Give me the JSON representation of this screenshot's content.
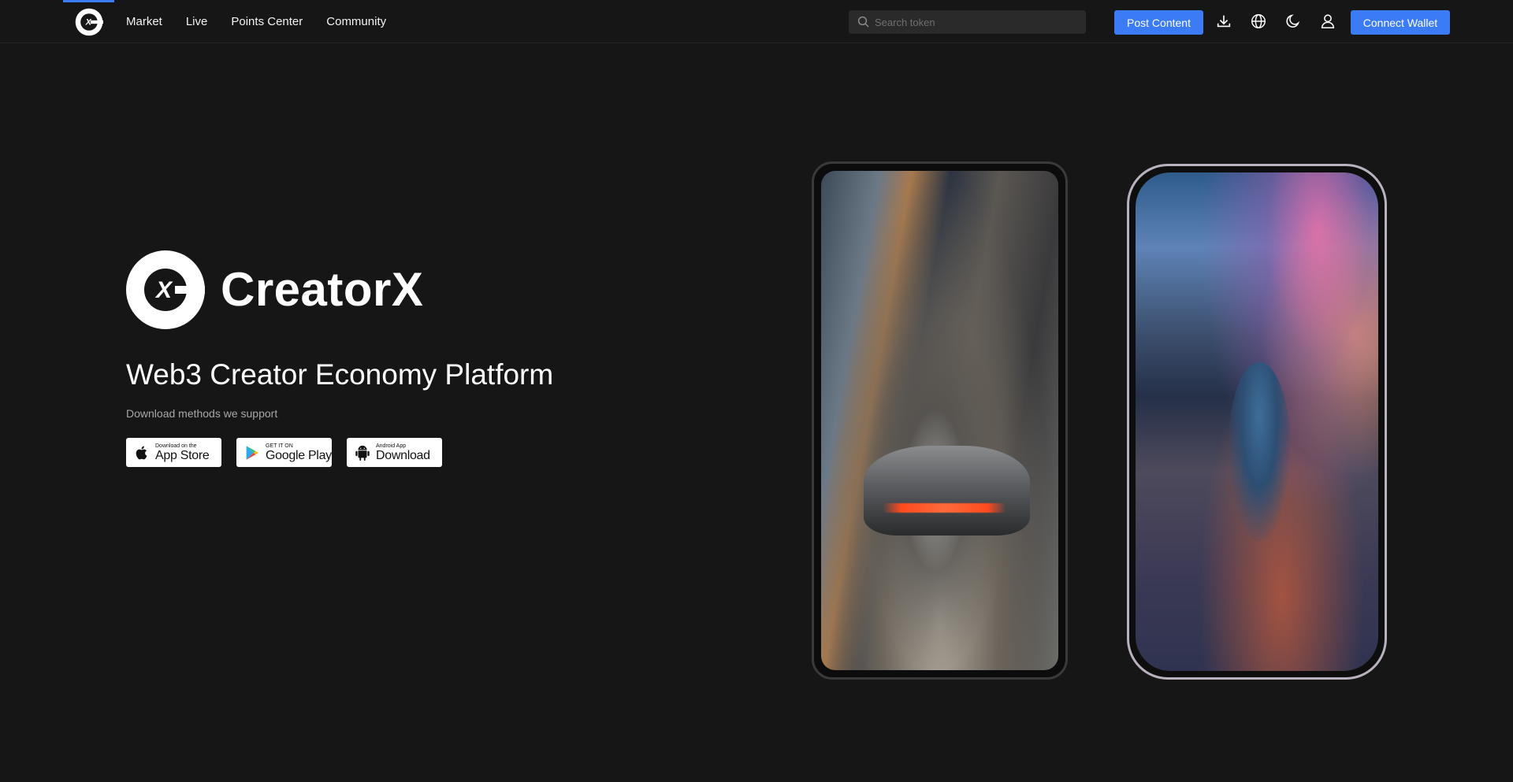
{
  "nav": {
    "brand_logo": "creatorx-logo",
    "links": [
      "Market",
      "Live",
      "Points Center",
      "Community"
    ],
    "search_placeholder": "Search token",
    "post_label": "Post Content",
    "wallet_label": "Connect Wallet",
    "icons": [
      "download-icon",
      "globe-icon",
      "moon-icon",
      "user-icon"
    ]
  },
  "hero": {
    "brand_name": "CreatorX",
    "tagline": "Web3 Creator Economy Platform",
    "download_label": "Download methods we support",
    "stores": [
      {
        "small": "Download on the",
        "big": "App Store",
        "icon": "apple-icon"
      },
      {
        "small": "GET IT ON",
        "big": "Google Play",
        "icon": "google-play-icon"
      },
      {
        "small": "Android App",
        "big": "Download",
        "icon": "android-icon"
      }
    ]
  },
  "colors": {
    "background": "#161616",
    "accent": "#3b7cf6",
    "text": "#ffffff",
    "muted": "#a8a8a8"
  }
}
